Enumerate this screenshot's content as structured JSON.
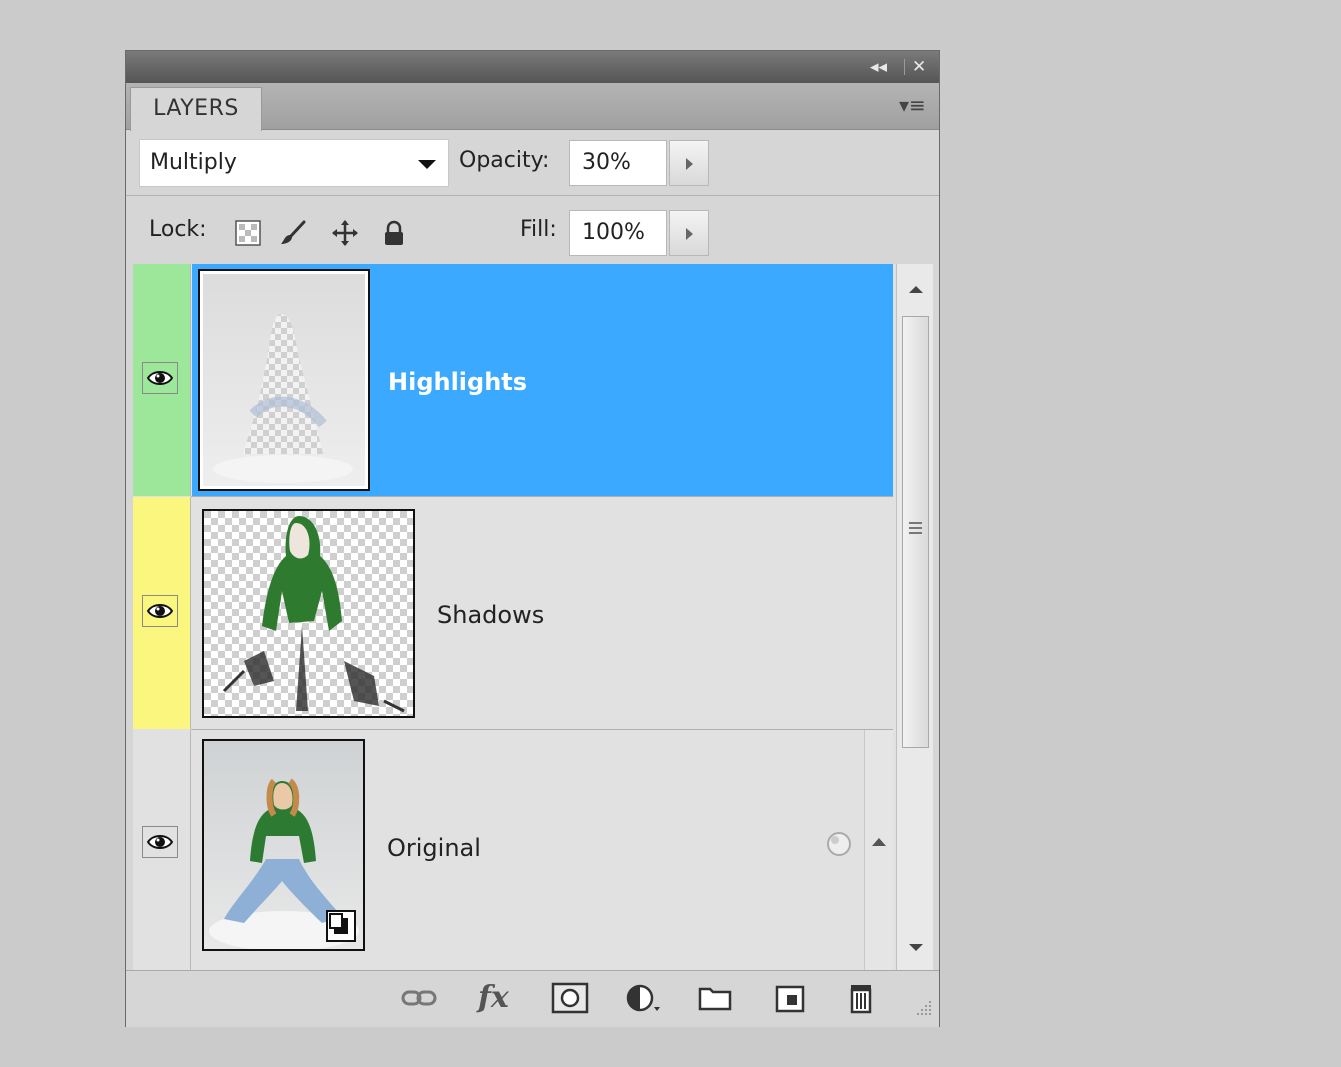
{
  "panel": {
    "tab_label": "LAYERS",
    "collapse_glyph": "◂◂",
    "close_glyph": "✕",
    "menu_glyph": "▾≡"
  },
  "blend_mode": {
    "selected": "Multiply"
  },
  "opacity": {
    "label": "Opacity:",
    "value": "30%"
  },
  "lock": {
    "label": "Lock:"
  },
  "fill": {
    "label": "Fill:",
    "value": "100%"
  },
  "layers": [
    {
      "name": "Highlights",
      "selected": true,
      "color_label": "#9de79a",
      "visible": true
    },
    {
      "name": "Shadows",
      "selected": false,
      "color_label": "#fbf67d",
      "visible": true
    },
    {
      "name": "Original",
      "selected": false,
      "color_label": "none",
      "visible": true,
      "locked_style": true
    }
  ],
  "colors": {
    "selection": "#3aa9ff",
    "label_green": "#9de79a",
    "label_yellow": "#fbf67d"
  },
  "bottom_icons": [
    "link-layers-icon",
    "fx-icon",
    "layer-mask-icon",
    "adjustment-layer-icon",
    "new-group-icon",
    "new-layer-icon",
    "trash-icon"
  ],
  "fx_text": "fx"
}
